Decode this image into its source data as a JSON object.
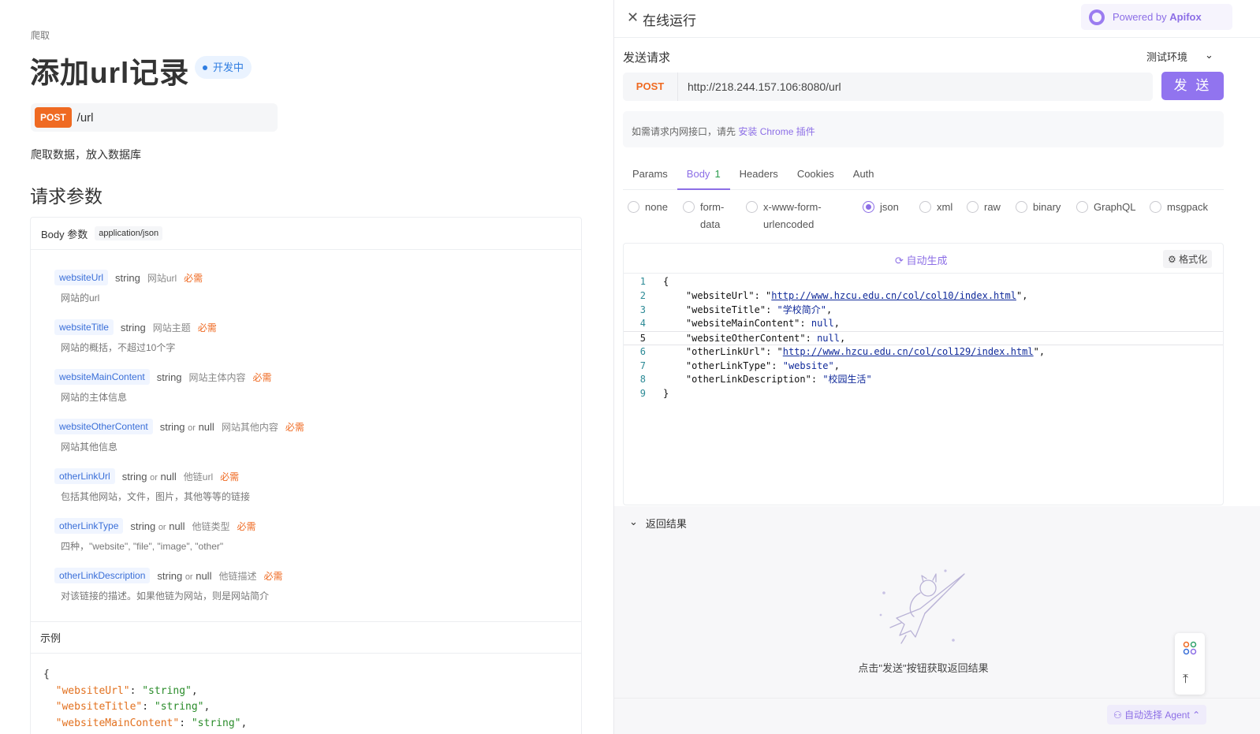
{
  "left": {
    "breadcrumb": "爬取",
    "title": "添加url记录",
    "status": "开发中",
    "method": "POST",
    "path": "/url",
    "description": "爬取数据，放入数据库",
    "section_title": "请求参数",
    "body_label": "Body 参数",
    "content_type": "application/json",
    "params": [
      {
        "name": "websiteUrl",
        "type": "string",
        "or_null": "",
        "short": "网站url",
        "required": "必需",
        "desc": "网站的url"
      },
      {
        "name": "websiteTitle",
        "type": "string",
        "or_null": "",
        "short": "网站主题",
        "required": "必需",
        "desc": "网站的概括，不超过10个字"
      },
      {
        "name": "websiteMainContent",
        "type": "string",
        "or_null": "",
        "short": "网站主体内容",
        "required": "必需",
        "desc": "网站的主体信息"
      },
      {
        "name": "websiteOtherContent",
        "type": "string",
        "or_null": "null",
        "short": "网站其他内容",
        "required": "必需",
        "desc": "网站其他信息"
      },
      {
        "name": "otherLinkUrl",
        "type": "string",
        "or_null": "null",
        "short": "他链url",
        "required": "必需",
        "desc": "包括其他网站，文件，图片，其他等等的链接"
      },
      {
        "name": "otherLinkType",
        "type": "string",
        "or_null": "null",
        "short": "他链类型",
        "required": "必需",
        "desc": "四种，\"website\", \"file\", \"image\", \"other\""
      },
      {
        "name": "otherLinkDescription",
        "type": "string",
        "or_null": "null",
        "short": "他链描述",
        "required": "必需",
        "desc": "对该链接的描述。如果他链为网站，则是网站简介"
      }
    ],
    "or_word": "or",
    "example_label": "示例",
    "example_lines": [
      {
        "key": "",
        "val": "",
        "raw": "{"
      },
      {
        "key": "\"websiteUrl\"",
        "val": "\"string\"",
        "raw": ""
      },
      {
        "key": "\"websiteTitle\"",
        "val": "\"string\"",
        "raw": ""
      },
      {
        "key": "\"websiteMainContent\"",
        "val": "\"string\"",
        "raw": ""
      }
    ]
  },
  "right": {
    "title": "在线运行",
    "powered_by": "Powered by",
    "brand": "Apifox",
    "send_title": "发送请求",
    "env": "测试环境",
    "method": "POST",
    "url": "http://218.244.157.106:8080/url",
    "send_button": "发 送",
    "hint_text": "如需请求内网接口，请先",
    "hint_link": "安装 Chrome 插件",
    "tabs": [
      {
        "label": "Params",
        "count": ""
      },
      {
        "label": "Body",
        "count": "1"
      },
      {
        "label": "Headers",
        "count": ""
      },
      {
        "label": "Cookies",
        "count": ""
      },
      {
        "label": "Auth",
        "count": ""
      }
    ],
    "body_types": [
      "none",
      "form-data",
      "x-www-form-urlencoded",
      "json",
      "xml",
      "raw",
      "binary",
      "GraphQL",
      "msgpack"
    ],
    "body_types_split": [
      {
        "line1": "none",
        "line2": ""
      },
      {
        "line1": "form-",
        "line2": "data"
      },
      {
        "line1": "x-www-form-",
        "line2": "urlencoded"
      },
      {
        "line1": "json",
        "line2": ""
      },
      {
        "line1": "xml",
        "line2": ""
      },
      {
        "line1": "raw",
        "line2": ""
      },
      {
        "line1": "binary",
        "line2": ""
      },
      {
        "line1": "GraphQL",
        "line2": ""
      },
      {
        "line1": "msgpack",
        "line2": ""
      }
    ],
    "selected_body_type": "json",
    "autogen": "自动生成",
    "format": "格式化",
    "code_lines": [
      {
        "n": "1",
        "pre": "{",
        "key": "",
        "mid": "",
        "val": "",
        "post": "",
        "url": false
      },
      {
        "n": "2",
        "pre": "    ",
        "key": "\"websiteUrl\"",
        "mid": ": \"",
        "val": "http://www.hzcu.edu.cn/col/col10/index.html",
        "post": "\",",
        "url": true
      },
      {
        "n": "3",
        "pre": "    ",
        "key": "\"websiteTitle\"",
        "mid": ": ",
        "val": "\"学校简介\"",
        "post": ",",
        "url": false
      },
      {
        "n": "4",
        "pre": "    ",
        "key": "\"websiteMainContent\"",
        "mid": ": ",
        "val": "null",
        "post": ",",
        "url": false
      },
      {
        "n": "5",
        "pre": "    ",
        "key": "\"websiteOtherContent\"",
        "mid": ": ",
        "val": "null",
        "post": ",",
        "url": false
      },
      {
        "n": "6",
        "pre": "    ",
        "key": "\"otherLinkUrl\"",
        "mid": ": \"",
        "val": "http://www.hzcu.edu.cn/col/col129/index.html",
        "post": "\",",
        "url": true
      },
      {
        "n": "7",
        "pre": "    ",
        "key": "\"otherLinkType\"",
        "mid": ": ",
        "val": "\"website\"",
        "post": ",",
        "url": false
      },
      {
        "n": "8",
        "pre": "    ",
        "key": "\"otherLinkDescription\"",
        "mid": ": ",
        "val": "\"校园生活\"",
        "post": "",
        "url": false
      },
      {
        "n": "9",
        "pre": "}",
        "key": "",
        "mid": "",
        "val": "",
        "post": "",
        "url": false
      }
    ],
    "active_line": "5",
    "result_title": "返回结果",
    "result_hint": "点击\"发送\"按钮获取返回结果",
    "agent": "自动选择 Agent"
  },
  "colors": {
    "accent": "#8c6ee6",
    "post": "#ef6a22",
    "param_name": "#3a6fd8"
  }
}
